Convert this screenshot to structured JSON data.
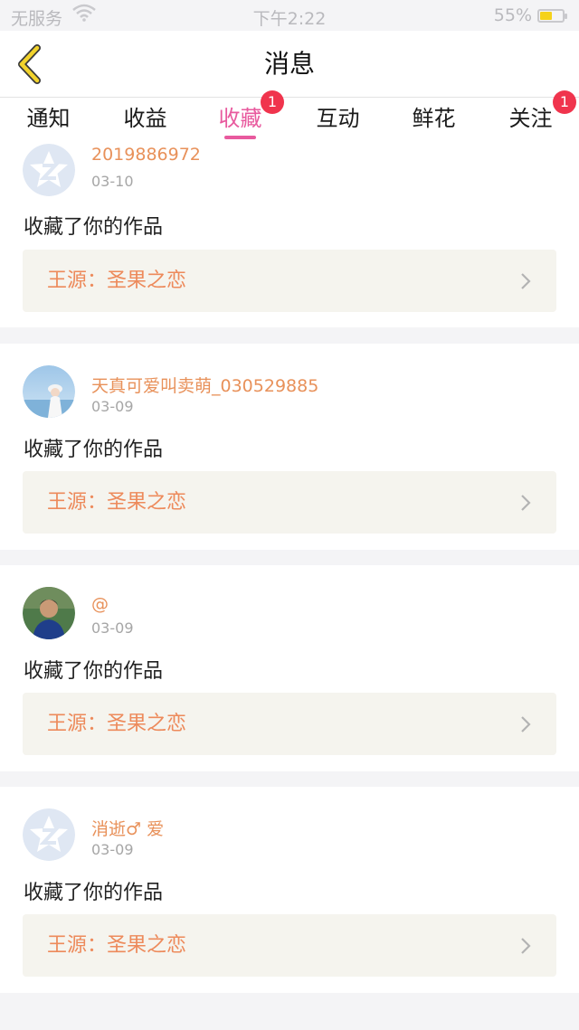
{
  "status_bar": {
    "carrier": "无服务",
    "time": "下午2:22",
    "battery_percent": "55%",
    "battery_level": 0.55,
    "wifi_icon": "wifi-icon"
  },
  "header": {
    "title": "消息",
    "back_icon": "back-chevron-icon"
  },
  "tabs": [
    {
      "label": "通知",
      "active": false,
      "badge": null
    },
    {
      "label": "收益",
      "active": false,
      "badge": null
    },
    {
      "label": "收藏",
      "active": true,
      "badge": "1"
    },
    {
      "label": "互动",
      "active": false,
      "badge": null
    },
    {
      "label": "鲜花",
      "active": false,
      "badge": null
    },
    {
      "label": "关注",
      "active": false,
      "badge": "1"
    }
  ],
  "colors": {
    "accent_pink": "#e85a9e",
    "username_orange": "#e8915a",
    "work_title_orange": "#ed8a5b",
    "badge_red": "#f0344d"
  },
  "messages": [
    {
      "username": "2019886972",
      "date": "03-10",
      "action": "收藏了你的作品",
      "work_title": "王源：圣果之恋",
      "avatar": "qq-default-avatar-icon"
    },
    {
      "username": "天真可爱叫卖萌_030529885",
      "date": "03-09",
      "action": "收藏了你的作品",
      "work_title": "王源：圣果之恋",
      "avatar": "photo-avatar-girl"
    },
    {
      "username": "@",
      "date": "03-09",
      "action": "收藏了你的作品",
      "work_title": "王源：圣果之恋",
      "avatar": "photo-avatar-man"
    },
    {
      "username": "消逝♂ 爱",
      "date": "03-09",
      "action": "收藏了你的作品",
      "work_title": "王源：圣果之恋",
      "avatar": "qq-default-avatar-icon"
    }
  ]
}
